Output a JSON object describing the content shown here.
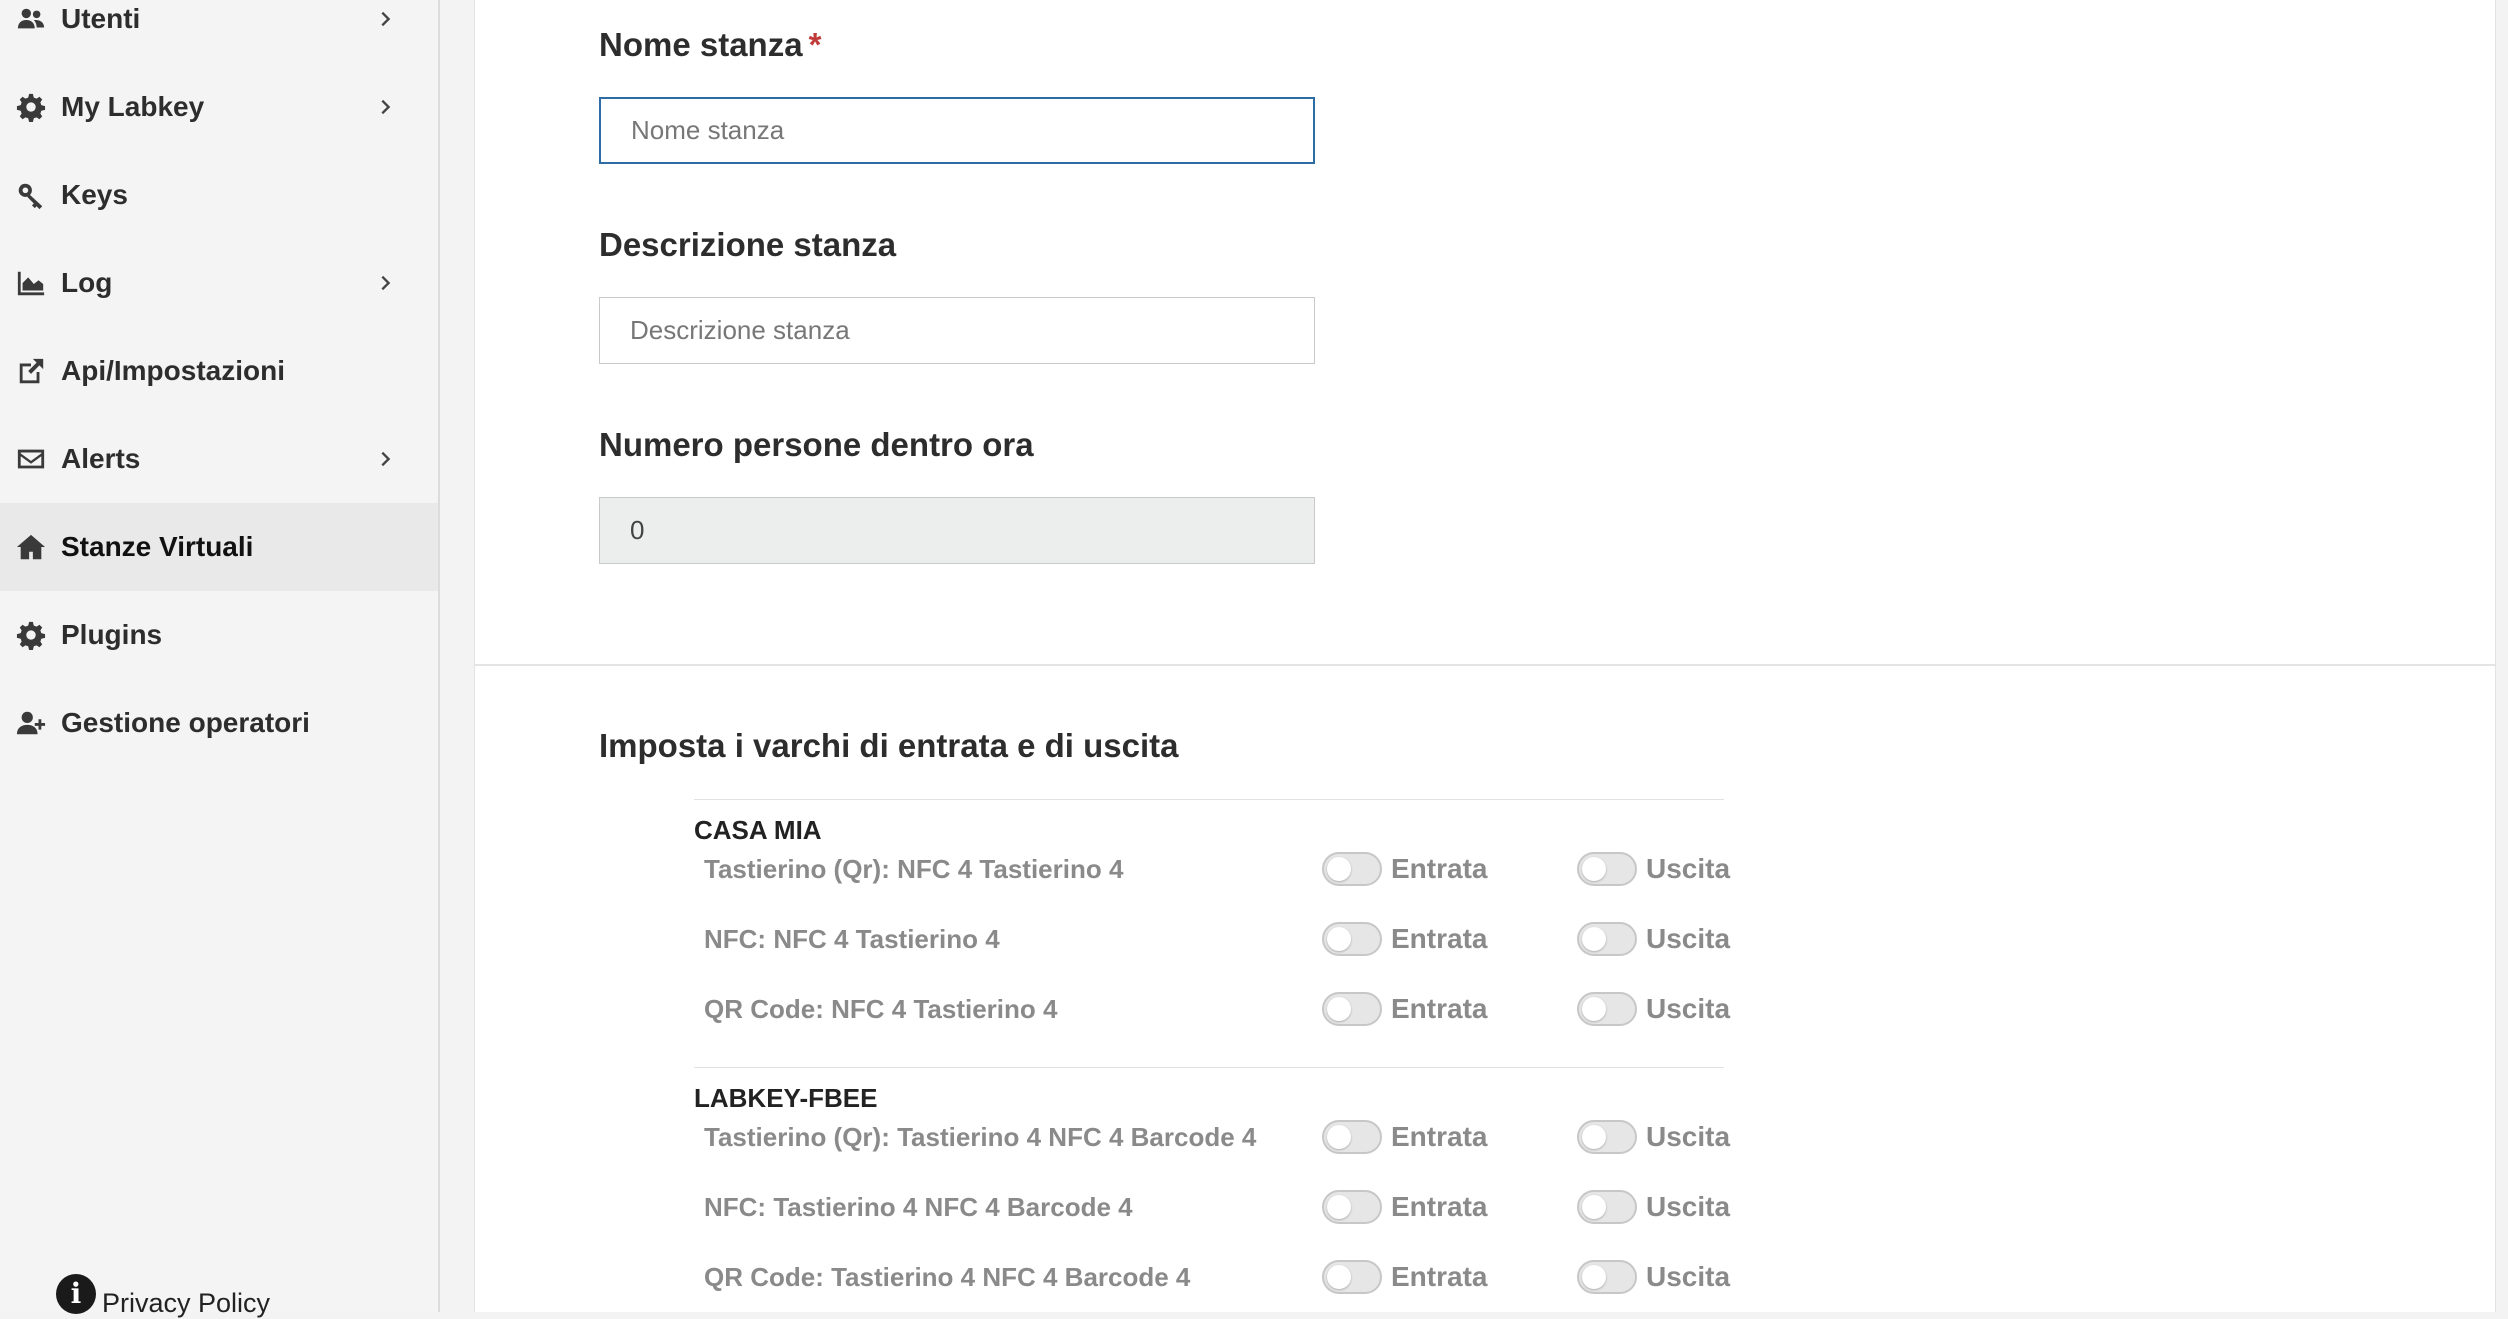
{
  "sidebar": {
    "items": [
      {
        "label": "Utenti",
        "icon": "users-icon",
        "has_submenu": true
      },
      {
        "label": "My Labkey",
        "icon": "gear-icon",
        "has_submenu": true
      },
      {
        "label": "Keys",
        "icon": "key-icon",
        "has_submenu": false
      },
      {
        "label": "Log",
        "icon": "area-chart-icon",
        "has_submenu": true
      },
      {
        "label": "Api/Impostazioni",
        "icon": "external-link-icon",
        "has_submenu": false
      },
      {
        "label": "Alerts",
        "icon": "envelope-icon",
        "has_submenu": true
      },
      {
        "label": "Stanze Virtuali",
        "icon": "home-icon",
        "has_submenu": false,
        "active": true
      },
      {
        "label": "Plugins",
        "icon": "gear-icon",
        "has_submenu": false
      },
      {
        "label": "Gestione operatori",
        "icon": "user-plus-icon",
        "has_submenu": false
      }
    ],
    "privacy_label": "Privacy Policy",
    "privacy_icon": "info-circle-icon"
  },
  "form": {
    "name": {
      "label": "Nome stanza",
      "required_mark": "*",
      "value": "",
      "placeholder": "Nome stanza"
    },
    "description": {
      "label": "Descrizione stanza",
      "value": "",
      "placeholder": "Descrizione stanza"
    },
    "people": {
      "label": "Numero persone dentro ora",
      "value": "0"
    }
  },
  "gates": {
    "title": "Imposta i varchi di entrata e di uscita",
    "entry_label": "Entrata",
    "exit_label": "Uscita",
    "groups": [
      {
        "name": "CASA MIA",
        "rows": [
          {
            "label": "Tastierino (Qr): NFC 4 Tastierino 4",
            "entry": false,
            "exit": false
          },
          {
            "label": "NFC: NFC 4 Tastierino 4",
            "entry": false,
            "exit": false
          },
          {
            "label": "QR Code: NFC 4 Tastierino 4",
            "entry": false,
            "exit": false
          }
        ]
      },
      {
        "name": "LABKEY-FBEE",
        "rows": [
          {
            "label": "Tastierino (Qr): Tastierino 4 NFC 4 Barcode 4",
            "entry": false,
            "exit": false
          },
          {
            "label": "NFC: Tastierino 4 NFC 4 Barcode 4",
            "entry": false,
            "exit": false
          },
          {
            "label": "QR Code: Tastierino 4 NFC 4 Barcode 4",
            "entry": false,
            "exit": false
          }
        ]
      }
    ]
  },
  "colors": {
    "focus_border": "#2e6da4",
    "required": "#c23b3b",
    "muted_text": "#8a8a8a",
    "active_nav_bg": "#e9e9e9"
  }
}
